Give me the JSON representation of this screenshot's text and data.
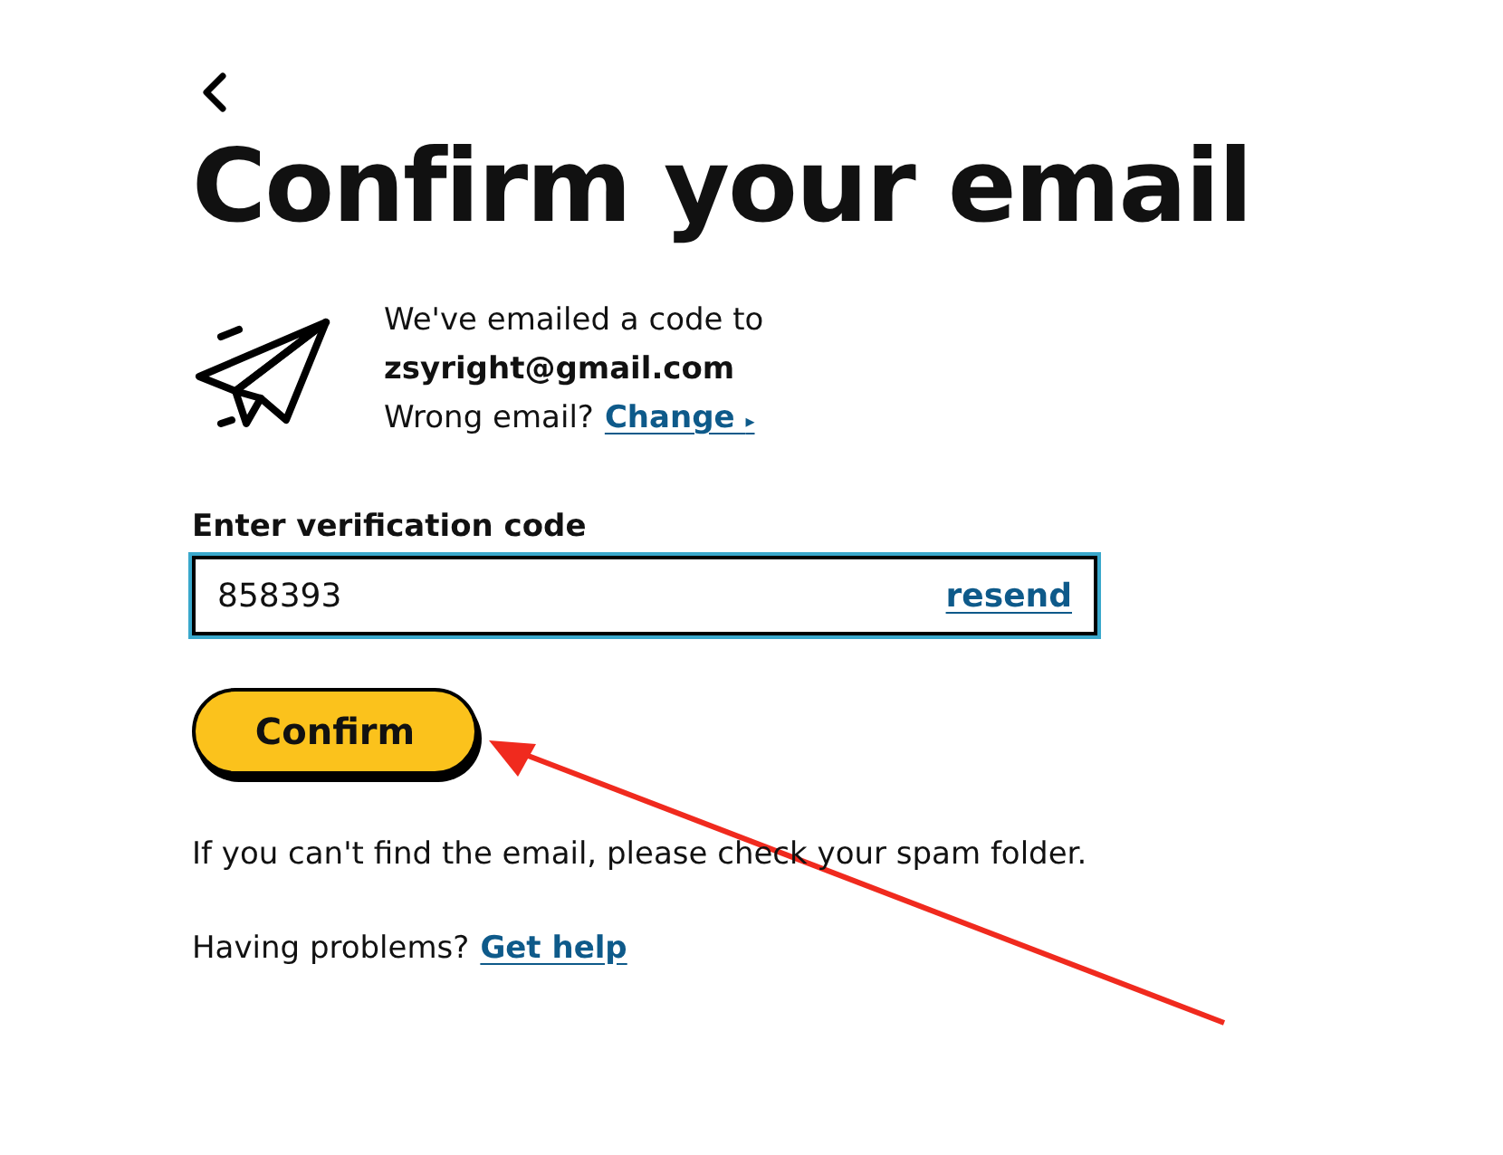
{
  "title": "Confirm your email",
  "notice": {
    "line": "We've emailed a code to",
    "email": "zsyright@gmail.com",
    "wrong": "Wrong email?",
    "change_link": "Change",
    "change_arrow": "▸"
  },
  "code_field": {
    "label": "Enter verification code",
    "value": "858393",
    "resend_link": "resend"
  },
  "confirm_button": "Confirm",
  "spam_hint": "If you can't find the email, please check your spam folder.",
  "help": {
    "text": "Having problems?",
    "link": "Get help"
  }
}
